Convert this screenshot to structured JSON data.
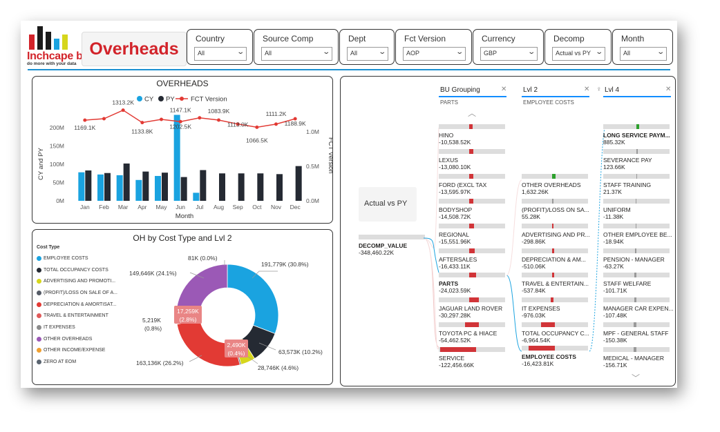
{
  "header": {
    "logo_text": "Inchcape bi",
    "logo_tagline": "do more with your data",
    "title": "Overheads"
  },
  "slicers": [
    {
      "label": "Country",
      "value": "All"
    },
    {
      "label": "Source Comp",
      "value": "All"
    },
    {
      "label": "Dept",
      "value": "All"
    },
    {
      "label": "Fct Version",
      "value": "AOP"
    },
    {
      "label": "Currency",
      "value": "GBP"
    },
    {
      "label": "Decomp",
      "value": "Actual vs PY"
    },
    {
      "label": "Month",
      "value": "All"
    }
  ],
  "overheads_chart": {
    "title": "OVERHEADS",
    "legend": [
      "CY",
      "PY",
      "FCT Version"
    ],
    "ylabel": "CY and PY",
    "y2label": "FCT Version",
    "xlabel": "Month",
    "left_ticks": [
      "0M",
      "50M",
      "100M",
      "150M",
      "200M"
    ],
    "right_ticks": [
      "0.0M",
      "0.5M",
      "1.0M"
    ],
    "colors": {
      "cy": "#1aa3e0",
      "py": "#252a33",
      "fct": "#e23a34"
    }
  },
  "donut_chart": {
    "title": "OH by Cost Type and Lvl 2",
    "legend_title": "Cost Type",
    "legend": [
      {
        "label": "EMPLOYEE COSTS",
        "color": "#1aa3e0"
      },
      {
        "label": "TOTAL OCCUPANCY COSTS",
        "color": "#252a33"
      },
      {
        "label": "ADVERTISING AND PROMOTI...",
        "color": "#d6d61c"
      },
      {
        "label": "(PROFIT)/LOSS ON SALE OF A...",
        "color": "#555b66"
      },
      {
        "label": "DEPRECIATION & AMORTISAT...",
        "color": "#e23a34"
      },
      {
        "label": "TRAVEL & ENTERTAINMENT",
        "color": "#e05a5a"
      },
      {
        "label": "IT EXPENSES",
        "color": "#8c8c8c"
      },
      {
        "label": "OTHER OVERHEADS",
        "color": "#9b59b6"
      },
      {
        "label": "OTHER INCOME/EXPENSE",
        "color": "#f0a030"
      },
      {
        "label": "ZERO AT EOM",
        "color": "#5a6470"
      }
    ],
    "labels": {
      "employee": "191,779K (30.8%)",
      "occupancy": "63,573K (10.2%)",
      "advertising": "28,746K (4.6%)",
      "depreciation": "163,136K (26.2%)",
      "other_overheads": "149,646K (24.1%)",
      "zero": "81K (0.0%)",
      "profit_loss_1": "5,219K",
      "profit_loss_2": "(0.8%)",
      "travel_1": "17,259K",
      "travel_2": "(2.8%)",
      "it_1": "2,490K",
      "it_2": "(0.4%)"
    }
  },
  "chart_data": [
    {
      "type": "bar",
      "title": "OVERHEADS",
      "xlabel": "Month",
      "ylabel": "CY and PY",
      "y2label": "FCT Version",
      "categories": [
        "Jan",
        "Feb",
        "Mar",
        "Apr",
        "May",
        "Jun",
        "Jul",
        "Aug",
        "Sep",
        "Oct",
        "Nov",
        "Dec"
      ],
      "ylim": [
        0,
        200
      ],
      "y2lim": [
        0,
        1.3
      ],
      "series": [
        {
          "name": "CY",
          "type": "bar",
          "values": [
            78,
            72,
            70,
            57,
            68,
            235,
            22,
            0,
            0,
            0,
            0,
            0
          ]
        },
        {
          "name": "PY",
          "type": "bar",
          "values": [
            83,
            76,
            102,
            80,
            77,
            65,
            84,
            75,
            75,
            75,
            73,
            95
          ]
        },
        {
          "name": "FCT Version",
          "type": "line",
          "axis": "right",
          "values": [
            1169.1,
            1190,
            1313.2,
            1133.8,
            1180,
            1147.1,
            1202.5,
            1170,
            1113.0,
            1066.5,
            1111.2,
            1188.9
          ]
        }
      ],
      "line_labels": [
        {
          "index": 0,
          "text": "1169.1K"
        },
        {
          "index": 2,
          "text": "1313.2K"
        },
        {
          "index": 3,
          "text": "1133.8K"
        },
        {
          "index": 5,
          "text": "1147.1K"
        },
        {
          "index": 5,
          "text": "1202.5K"
        },
        {
          "index": 7,
          "text": "1083.9K"
        },
        {
          "index": 8,
          "text": "1113.0K"
        },
        {
          "index": 9,
          "text": "1066.5K"
        },
        {
          "index": 10,
          "text": "1111.2K"
        },
        {
          "index": 11,
          "text": "1188.9K"
        }
      ]
    },
    {
      "type": "pie",
      "title": "OH by Cost Type and Lvl 2",
      "categories": [
        "EMPLOYEE COSTS",
        "TOTAL OCCUPANCY COSTS",
        "ADVERTISING AND PROMOTI...",
        "(PROFIT)/LOSS ON SALE OF A...",
        "DEPRECIATION & AMORTISAT...",
        "TRAVEL & ENTERTAINMENT",
        "IT EXPENSES",
        "OTHER OVERHEADS",
        "OTHER INCOME/EXPENSE",
        "ZERO AT EOM"
      ],
      "values": [
        30.8,
        10.2,
        4.6,
        0.4,
        26.2,
        2.8,
        0.8,
        24.1,
        0.0,
        0.0
      ]
    }
  ],
  "decomp_tree": {
    "root": {
      "label": "Actual vs PY",
      "node_label": "DECOMP_VALUE",
      "node_value": "-348,460.22K"
    },
    "columns": [
      {
        "header": "BU Grouping",
        "sub": "PARTS"
      },
      {
        "header": "Lvl 2",
        "sub": "EMPLOYEE COSTS"
      },
      {
        "header": "Lvl 4",
        "sub": ""
      }
    ],
    "bu_nodes": [
      {
        "label": "HINO",
        "value": "-10,538.52K"
      },
      {
        "label": "LEXUS",
        "value": "-13,080.10K"
      },
      {
        "label": "FORD (EXCL TAX",
        "value": "-13,595.97K"
      },
      {
        "label": "BODYSHOP",
        "value": "-14,508.72K"
      },
      {
        "label": "REGIONAL",
        "value": "-15,551.96K"
      },
      {
        "label": "AFTERSALES",
        "value": "-16,433.11K"
      },
      {
        "label": "PARTS",
        "value": "-24,023.59K"
      },
      {
        "label": "JAGUAR LAND ROVER",
        "value": "-30,297.28K"
      },
      {
        "label": "TOYOTA PC & HIACE",
        "value": "-54,462.52K"
      },
      {
        "label": "SERVICE",
        "value": "-122,456.66K"
      }
    ],
    "lvl2_nodes": [
      {
        "label": "OTHER OVERHEADS",
        "value": "1,632.26K"
      },
      {
        "label": "(PROFIT)/LOSS ON SA...",
        "value": "55.28K"
      },
      {
        "label": "ADVERTISING AND PR...",
        "value": "-298.86K"
      },
      {
        "label": "DEPRECIATION & AM...",
        "value": "-510.06K"
      },
      {
        "label": "TRAVEL & ENTERTAIN...",
        "value": "-537.84K"
      },
      {
        "label": "IT EXPENSES",
        "value": "-976.03K"
      },
      {
        "label": "TOTAL OCCUPANCY C...",
        "value": "-6,964.54K"
      },
      {
        "label": "EMPLOYEE COSTS",
        "value": "-16,423.81K"
      }
    ],
    "lvl4_nodes": [
      {
        "label": "LONG SERVICE PAYM...",
        "value": "885.32K"
      },
      {
        "label": "SEVERANCE PAY",
        "value": "123.66K"
      },
      {
        "label": "STAFF TRAINING",
        "value": "21.37K"
      },
      {
        "label": "UNIFORM",
        "value": "-11.38K"
      },
      {
        "label": "OTHER EMPLOYEE BE...",
        "value": "-18.94K"
      },
      {
        "label": "PENSION - MANAGER",
        "value": "-63.27K"
      },
      {
        "label": "STAFF WELFARE",
        "value": "-101.71K"
      },
      {
        "label": "MANAGER CAR EXPEN...",
        "value": "-107.48K"
      },
      {
        "label": "MPF - GENERAL STAFF",
        "value": "-150.38K"
      },
      {
        "label": "MEDICAL - MANAGER",
        "value": "-156.71K"
      }
    ]
  }
}
